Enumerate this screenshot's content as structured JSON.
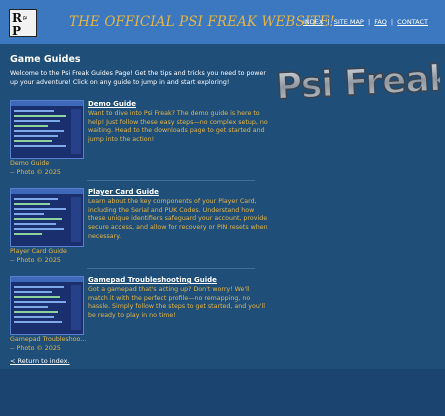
{
  "header": {
    "title": "THE OFFICIAL PSI FREAK WEBSITE!",
    "logo_text": [
      "R",
      "a",
      "P"
    ],
    "nav": [
      "INDEX",
      "SITE MAP",
      "FAQ",
      "CONTACT"
    ]
  },
  "main": {
    "heading": "Game Guides",
    "intro": "Welcome to the Psi Freak Guides Page! Get the tips and tricks you need to power up your adventure! Click on any guide to jump in and start exploring!",
    "brand_logo_text": "Psi Freak",
    "guides": [
      {
        "title": "Demo Guide",
        "description": "Want to dive into Psi Freak? The demo guide is here to help! Just follow these easy steps—no complex setup, no waiting. Head to the downloads page to get started and jump into the action!",
        "caption_name": "Demo Guide",
        "caption_credit": "-- Photo © 2025"
      },
      {
        "title": "Player Card Guide",
        "description": "Learn about the key components of your Player Card, including the Serial and PUK Codes. Understand how these unique identifiers safeguard your account, provide secure access, and allow for recovery or PIN resets when necessary.",
        "caption_name": "Player Card Guide",
        "caption_credit": "-- Photo © 2025"
      },
      {
        "title": "Gamepad Troubleshooting Guide",
        "description": "Got a gamepad that's acting up? Don't worry! We'll match it with the perfect profile—no remapping, no hassle. Simply follow the steps to get started, and you'll be ready to play in no time!",
        "caption_name": "Gamepad Troubleshoo...",
        "caption_credit": "-- Photo © 2025"
      }
    ],
    "back_link": "< Return to index."
  },
  "colors": {
    "background": "#1f4e79",
    "header": "#3b78bf",
    "accent": "#e3b546",
    "link": "#ffffff"
  }
}
